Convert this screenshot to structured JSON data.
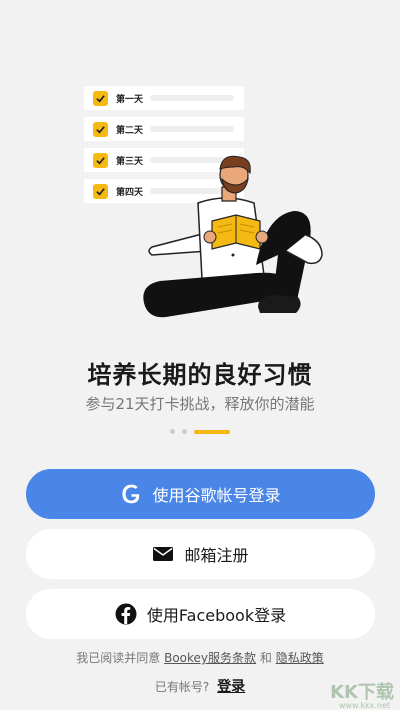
{
  "illustration": {
    "checklist": [
      {
        "label": "第一天"
      },
      {
        "label": "第二天"
      },
      {
        "label": "第三天"
      },
      {
        "label": "第四天"
      }
    ]
  },
  "intro": {
    "title": "培养长期的良好习惯",
    "subtitle": "参与21天打卡挑战，释放你的潜能"
  },
  "pager": {
    "total": 3,
    "active_index": 3
  },
  "buttons": {
    "google_label": "使用谷歌帐号登录",
    "email_label": "邮箱注册",
    "facebook_label": "使用Facebook登录"
  },
  "terms": {
    "prefix": "我已阅读并同意 ",
    "service_link": "Bookey服务条款",
    "joiner": " 和 ",
    "privacy_link": "隐私政策"
  },
  "account": {
    "prompt": "已有帐号?",
    "login_link": "登录"
  },
  "watermark": {
    "text": "KK下载",
    "url": "www.kkx.net"
  },
  "colors": {
    "accent": "#f5b914",
    "google_blue": "#4a86e8",
    "background": "#f2f2f2"
  }
}
